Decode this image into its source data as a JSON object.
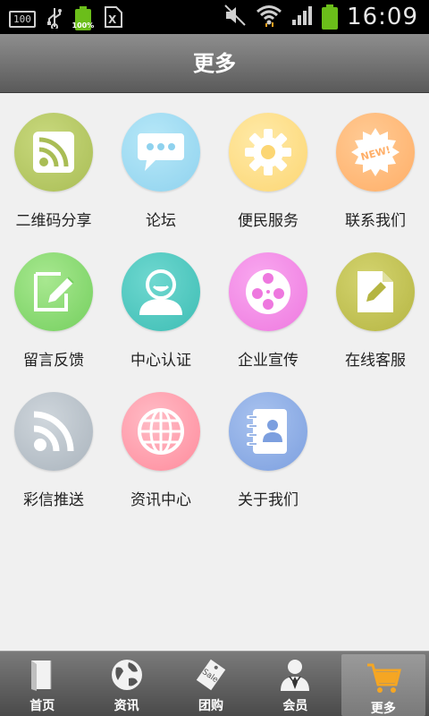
{
  "status_bar": {
    "indicator_box": "100",
    "battery_small_pct": "100%",
    "clock": "16:09"
  },
  "header": {
    "title": "更多"
  },
  "colors": {
    "share": "#b9cc6a",
    "forum": "#9fdcf2",
    "service": "#ffe08a",
    "contact": "#ffb977",
    "feedback": "#8fdc7a",
    "auth": "#4dc8c0",
    "promo": "#f58ae6",
    "support": "#c7c758",
    "push": "#bcc5cc",
    "news": "#ff9fae",
    "about": "#8fb0e6"
  },
  "grid": {
    "items": [
      {
        "label": "二维码分享",
        "icon": "rss-icon"
      },
      {
        "label": "论坛",
        "icon": "chat-bubble-icon"
      },
      {
        "label": "便民服务",
        "icon": "gear-icon"
      },
      {
        "label": "联系我们",
        "icon": "new-badge-icon",
        "badge": "NEW!"
      },
      {
        "label": "留言反馈",
        "icon": "edit-icon"
      },
      {
        "label": "中心认证",
        "icon": "user-icon"
      },
      {
        "label": "企业宣传",
        "icon": "film-reel-icon"
      },
      {
        "label": "在线客服",
        "icon": "document-edit-icon"
      },
      {
        "label": "彩信推送",
        "icon": "rss-icon"
      },
      {
        "label": "资讯中心",
        "icon": "globe-icon"
      },
      {
        "label": "关于我们",
        "icon": "address-book-icon"
      }
    ]
  },
  "bottom_nav": {
    "items": [
      {
        "label": "首页",
        "icon": "book-icon"
      },
      {
        "label": "资讯",
        "icon": "globe-icon"
      },
      {
        "label": "团购",
        "icon": "sale-tag-icon",
        "tag_text": "Sale"
      },
      {
        "label": "会员",
        "icon": "member-icon"
      },
      {
        "label": "更多",
        "icon": "cart-icon",
        "active": true
      }
    ]
  }
}
